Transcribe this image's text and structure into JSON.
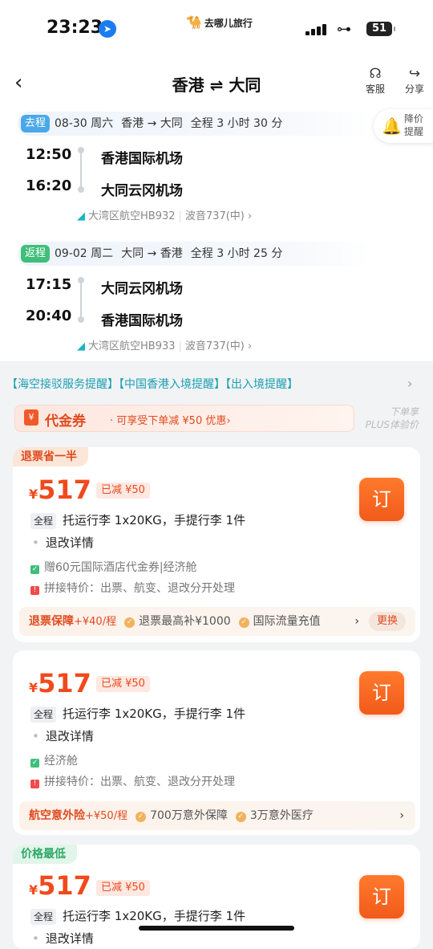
{
  "status": {
    "time": "23:23",
    "brand": "去哪儿旅行",
    "battery": "51"
  },
  "nav": {
    "title": "香港 ⇌ 大同",
    "service": "客服",
    "share": "分享"
  },
  "outbound": {
    "tag": "去程",
    "date": "08-30 周六",
    "route": "香港 → 大同",
    "duration": "全程 3 小时 30 分",
    "dep_time": "12:50",
    "dep_airport": "香港国际机场",
    "arr_time": "16:20",
    "arr_airport": "大同云冈机场",
    "airline": "大湾区航空HB932",
    "aircraft": "波音737(中)"
  },
  "return": {
    "tag": "返程",
    "date": "09-02 周二",
    "route": "大同 → 香港",
    "duration": "全程 3 小时 25 分",
    "dep_time": "17:15",
    "dep_airport": "大同云冈机场",
    "arr_time": "20:40",
    "arr_airport": "香港国际机场",
    "airline": "大湾区航空HB933",
    "aircraft": "波音737(中)"
  },
  "price_alert": {
    "line1": "降价",
    "line2": "提醒"
  },
  "notices": "【海空接驳服务提醒】【中国香港入境提醒】【出入境提醒】",
  "voucher": {
    "title": "代金券",
    "desc": "· 可享受下单减 ¥50 优惠›"
  },
  "plus": {
    "line1": "下单享",
    "line2": "PLUS体验价"
  },
  "cards": [
    {
      "badge": "退票省一半",
      "currency": "¥",
      "price": "517",
      "discount": "已减 ¥50",
      "luggage_tag": "全程",
      "luggage": "托运行李 1x20KG，手提行李 1件",
      "refund": "退改详情",
      "feature1": "赠60元国际酒店代金券|经济舱",
      "feature2": "拼接特价：出票、航变、退改分开处理",
      "ins_name": "退票保障",
      "ins_fee": "+¥40/程",
      "ins_items": [
        "退票最高补¥1000",
        "国际流量充值"
      ],
      "change": "更换",
      "book": "订"
    },
    {
      "currency": "¥",
      "price": "517",
      "discount": "已减 ¥50",
      "luggage_tag": "全程",
      "luggage": "托运行李 1x20KG，手提行李 1件",
      "refund": "退改详情",
      "feature1": "经济舱",
      "feature2": "拼接特价：出票、航变、退改分开处理",
      "ins_name": "航空意外险",
      "ins_fee": "+¥50/程",
      "ins_items": [
        "700万意外保障",
        "3万意外医疗"
      ],
      "book": "订"
    },
    {
      "badge": "价格最低",
      "currency": "¥",
      "price": "517",
      "discount": "已减 ¥50",
      "luggage_tag": "全程",
      "luggage": "托运行李 1x20KG，手提行李 1件",
      "refund": "退改详情",
      "book": "订"
    }
  ]
}
